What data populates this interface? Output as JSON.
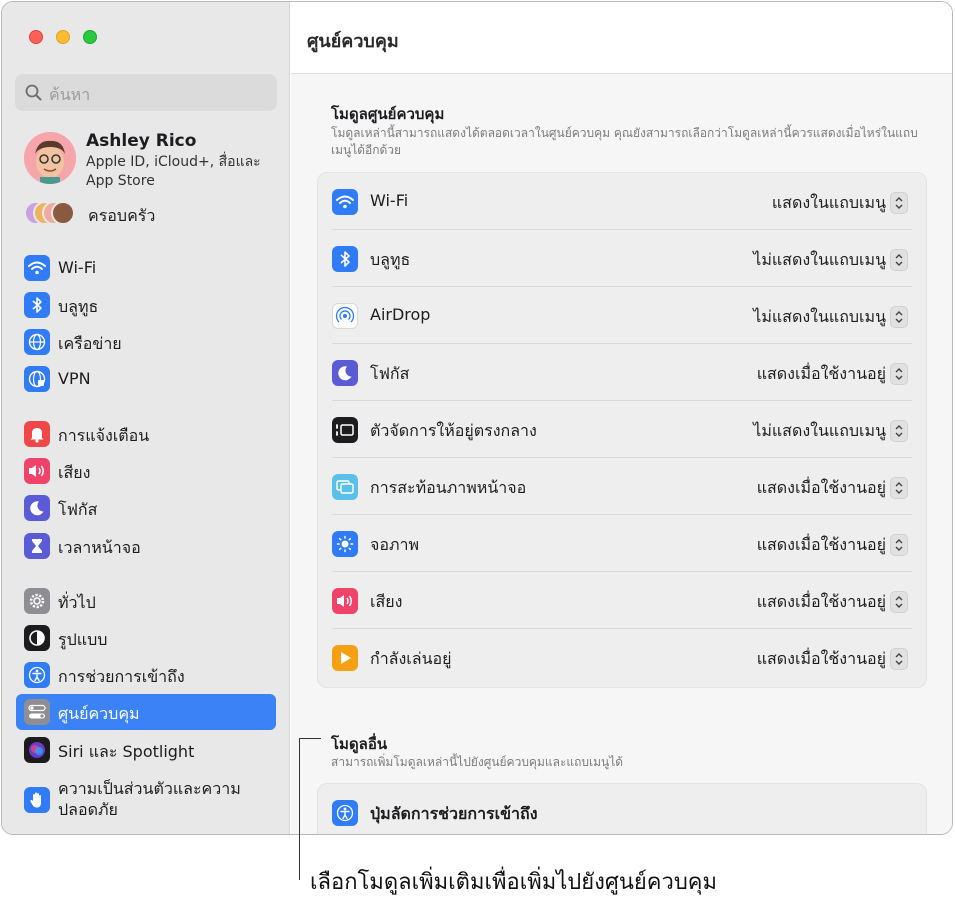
{
  "window": {
    "title": "ศูนย์ควบคุม"
  },
  "search": {
    "placeholder": "ค้นหา"
  },
  "profile": {
    "name": "Ashley Rico",
    "subtitle": "Apple ID, iCloud+, สื่อและ App Store"
  },
  "family": {
    "label": "ครอบครัว"
  },
  "sidebar": {
    "items": [
      {
        "label": "Wi-Fi",
        "icon": "wifi-icon"
      },
      {
        "label": "บลูทูธ",
        "icon": "bluetooth-icon"
      },
      {
        "label": "เครือข่าย",
        "icon": "globe-icon"
      },
      {
        "label": "VPN",
        "icon": "vpn-globe-icon"
      },
      {
        "label": "การแจ้งเตือน",
        "icon": "bell-icon"
      },
      {
        "label": "เสียง",
        "icon": "speaker-icon"
      },
      {
        "label": "โฟกัส",
        "icon": "moon-icon"
      },
      {
        "label": "เวลาหน้าจอ",
        "icon": "hourglass-icon"
      },
      {
        "label": "ทั่วไป",
        "icon": "gear-icon"
      },
      {
        "label": "รูปแบบ",
        "icon": "appearance-icon"
      },
      {
        "label": "การช่วยการเข้าถึง",
        "icon": "accessibility-icon"
      },
      {
        "label": "ศูนย์ควบคุม",
        "icon": "control-center-icon",
        "selected": true
      },
      {
        "label": "Siri และ Spotlight",
        "icon": "siri-icon"
      },
      {
        "label": "ความเป็นส่วนตัวและความปลอดภัย",
        "icon": "hand-icon"
      }
    ]
  },
  "control_modules": {
    "title": "โมดูลศูนย์ควบคุม",
    "description": "โมดูลเหล่านี้สามารถแสดงได้ตลอดเวลาในศูนย์ควบคุม คุณยังสามารถเลือกว่าโมดูลเหล่านี้ควรแสดงเมื่อไหร่ในแถบเมนูได้อีกด้วย",
    "rows": [
      {
        "label": "Wi-Fi",
        "value": "แสดงในแถบเมนู",
        "icon": "wifi-icon"
      },
      {
        "label": "บลูทูธ",
        "value": "ไม่แสดงในแถบเมนู",
        "icon": "bluetooth-icon"
      },
      {
        "label": "AirDrop",
        "value": "ไม่แสดงในแถบเมนู",
        "icon": "airdrop-icon"
      },
      {
        "label": "โฟกัส",
        "value": "แสดงเมื่อใช้งานอยู่",
        "icon": "moon-icon"
      },
      {
        "label": "ตัวจัดการให้อยู่ตรงกลาง",
        "value": "ไม่แสดงในแถบเมนู",
        "icon": "stage-manager-icon"
      },
      {
        "label": "การสะท้อนภาพหน้าจอ",
        "value": "แสดงเมื่อใช้งานอยู่",
        "icon": "screen-mirroring-icon"
      },
      {
        "label": "จอภาพ",
        "value": "แสดงเมื่อใช้งานอยู่",
        "icon": "sun-icon"
      },
      {
        "label": "เสียง",
        "value": "แสดงเมื่อใช้งานอยู่",
        "icon": "speaker-icon"
      },
      {
        "label": "กำลังเล่นอยู่",
        "value": "แสดงเมื่อใช้งานอยู่",
        "icon": "play-icon"
      }
    ]
  },
  "other_modules": {
    "title": "โมดูลอื่น",
    "description": "สามารถเพิ่มโมดูลเหล่านี้ไปยังศูนย์ควบคุมและแถบเมนูได้",
    "rows": [
      {
        "label": "ปุ่มลัดการช่วยการเข้าถึง",
        "icon": "accessibility-icon"
      }
    ]
  },
  "callout": {
    "text": "เลือกโมดูลเพิ่มเติมเพื่อเพิ่มไปยังศูนย์ควบคุม"
  },
  "colors": {
    "accent": "#3a82f6",
    "sidebar_bg": "#e9e8e8"
  }
}
